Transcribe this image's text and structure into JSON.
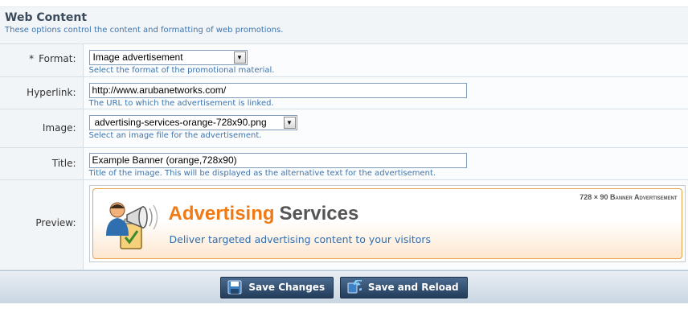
{
  "section": {
    "title": "Web Content",
    "description": "These options control the content and formatting of web promotions."
  },
  "fields": {
    "format": {
      "required_mark": "*",
      "label": "Format:",
      "value": "Image advertisement",
      "help": "Select the format of the promotional material."
    },
    "hyperlink": {
      "label": "Hyperlink:",
      "value": "http://www.arubanetworks.com/",
      "help": "The URL to which the advertisement is linked."
    },
    "image": {
      "label": "Image:",
      "value": "advertising-services-orange-728x90.png",
      "help": "Select an image file for the advertisement."
    },
    "title": {
      "label": "Title:",
      "value": "Example Banner (orange,728x90)",
      "help": "Title of the image. This will be displayed as the alternative text for the advertisement."
    },
    "preview": {
      "label": "Preview:"
    }
  },
  "banner": {
    "badge": "728 × 90 Banner Advertisement",
    "title_part1": "Advertising",
    "title_part2": "Services",
    "subtitle": "Deliver targeted advertising content to your visitors"
  },
  "buttons": {
    "save": "Save Changes",
    "save_reload": "Save and Reload"
  },
  "colors": {
    "accent_orange": "#f07b16",
    "link_blue": "#3d74ad",
    "button_navy": "#2b4566"
  },
  "icons": {
    "save": "floppy-disk-icon",
    "save_reload": "save-and-reload-icon",
    "banner": "megaphone-person-icon"
  }
}
